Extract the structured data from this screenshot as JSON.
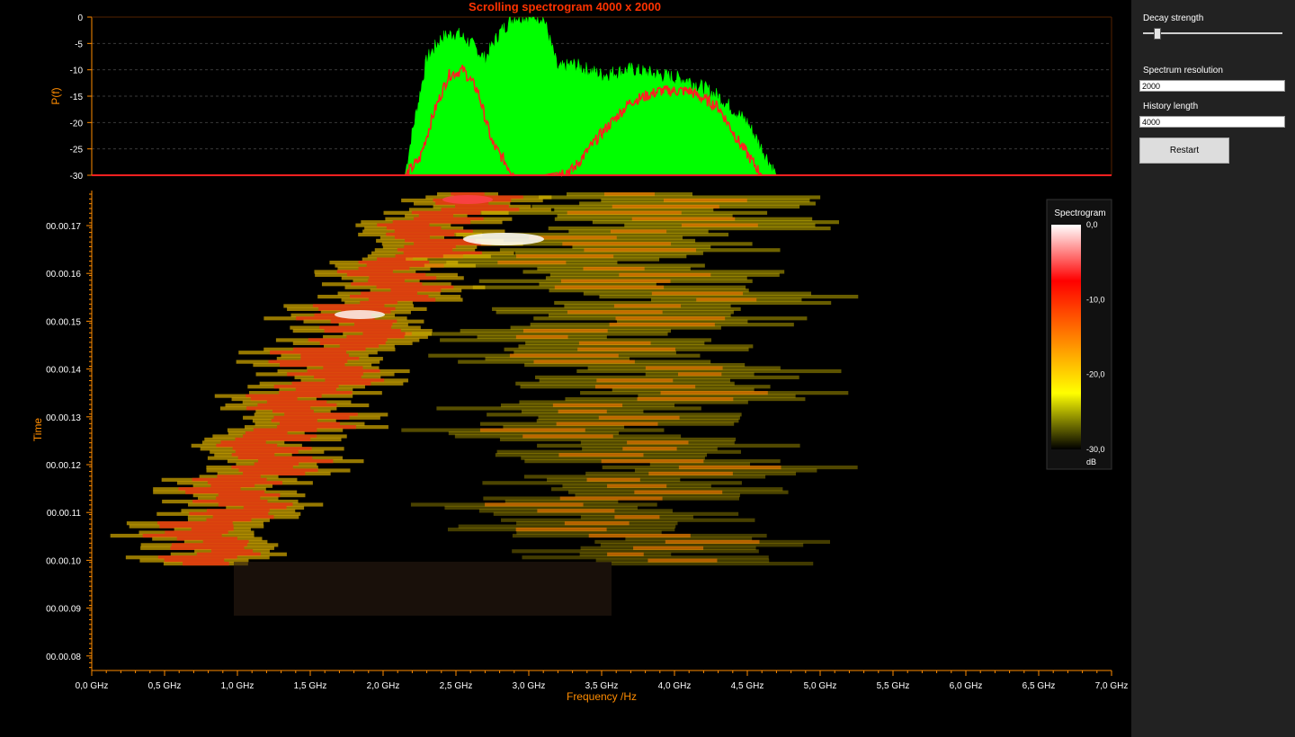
{
  "chart_data": [
    {
      "type": "area",
      "title": "Scrolling spectrogram 4000 x 2000",
      "ylabel": "P(f)",
      "xlabel": "",
      "ylim": [
        -30,
        0
      ],
      "yticks": [
        "0",
        "-5",
        "-10",
        "-15",
        "-20",
        "-25",
        "-30"
      ],
      "xlim": [
        0,
        7
      ],
      "series": [
        {
          "name": "",
          "color": "#00ff00",
          "x": [
            2.15,
            2.2,
            2.3,
            2.4,
            2.5,
            2.6,
            2.7,
            2.8,
            2.9,
            3.0,
            3.1,
            3.2,
            3.3,
            3.5,
            3.7,
            3.9,
            4.1,
            4.3,
            4.5,
            4.6,
            4.7
          ],
          "values": [
            -30,
            -22,
            -8,
            -4,
            -3,
            -5,
            -8,
            -3,
            0,
            0,
            0,
            -10,
            -9,
            -11,
            -10,
            -11,
            -12,
            -15,
            -20,
            -25,
            -30
          ]
        },
        {
          "name": "",
          "color": "#ff2020",
          "x": [
            2.15,
            2.25,
            2.35,
            2.45,
            2.55,
            2.65,
            2.75,
            2.9,
            3.1,
            3.3,
            3.5,
            3.7,
            3.9,
            4.1,
            4.3,
            4.45,
            4.6,
            4.7
          ],
          "values": [
            -30,
            -27,
            -18,
            -11,
            -10,
            -14,
            -24,
            -30,
            -30,
            -29,
            -22,
            -16,
            -14,
            -14,
            -17,
            -24,
            -30,
            -30
          ]
        }
      ]
    },
    {
      "type": "heatmap",
      "title": "Spectrogram",
      "xlabel": "Frequency /Hz",
      "ylabel": "Time",
      "xticks": [
        "0,0 GHz",
        "0,5 GHz",
        "1,0 GHz",
        "1,5 GHz",
        "2,0 GHz",
        "2,5 GHz",
        "3,0 GHz",
        "3,5 GHz",
        "4,0 GHz",
        "4,5 GHz",
        "5,0 GHz",
        "5,5 GHz",
        "6,0 GHz",
        "6,5 GHz",
        "7,0 GHz"
      ],
      "yticks": [
        "00.00.17",
        "00.00.16",
        "00.00.15",
        "00.00.14",
        "00.00.13",
        "00.00.12",
        "00.00.11",
        "00.00.10",
        "00.00.09",
        "00.00.08"
      ],
      "legend": {
        "title": "Spectrogram",
        "labels": [
          "0,0",
          "-10,0",
          "-20,0",
          "-30,0"
        ],
        "unit": "dB",
        "placement": "top-right"
      },
      "colorscale": [
        "#ffffff",
        "#ff0000",
        "#ff8000",
        "#ffff00",
        "#000000"
      ]
    }
  ],
  "sidebar": {
    "decay_label": "Decay strength",
    "decay_value": 0.1,
    "resolution_label": "Spectrum resolution",
    "resolution_value": "2000",
    "history_label": "History length",
    "history_value": "4000",
    "restart_label": "Restart"
  },
  "colors": {
    "axis": "#ff8c00",
    "title": "#ff3300",
    "panel_bg": "#222222"
  }
}
